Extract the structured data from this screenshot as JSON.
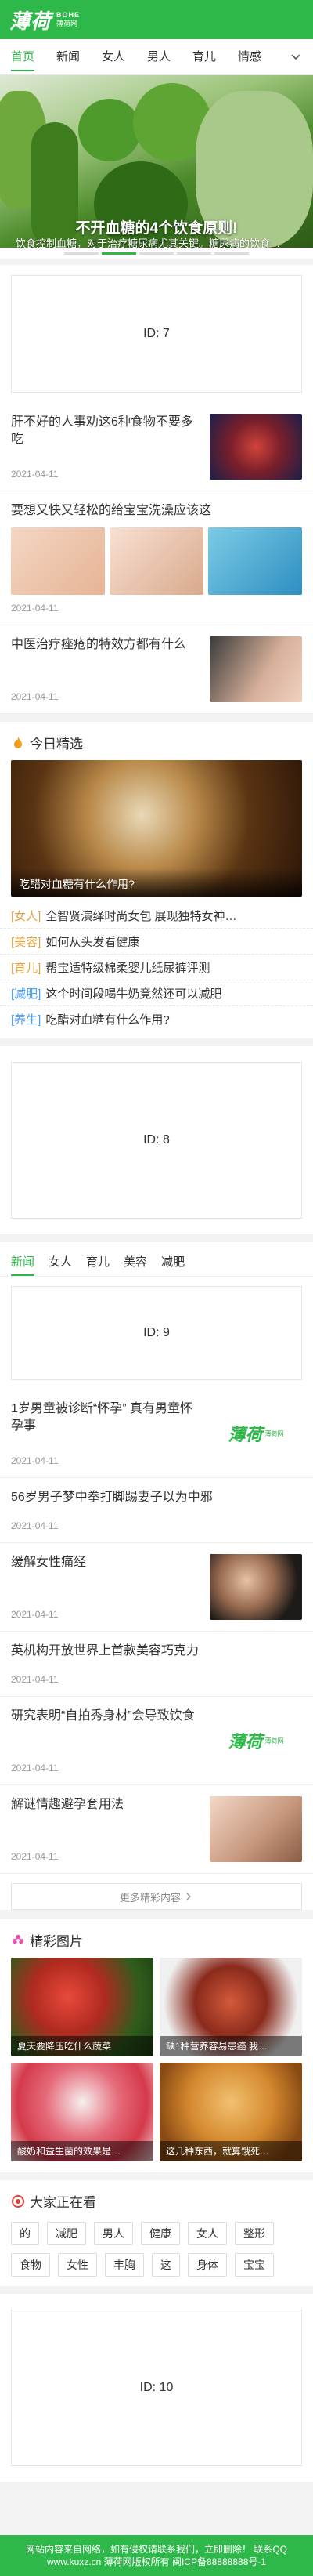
{
  "header": {
    "logo_text": "薄荷",
    "logo_en": "BOHE",
    "logo_sub": "薄荷网"
  },
  "nav": {
    "items": [
      "首页",
      "新闻",
      "女人",
      "男人",
      "育儿",
      "情感"
    ]
  },
  "hero": {
    "title": "不开血糖的4个饮食原则!",
    "desc": "饮食控制血糖，对于治疗糖尿病尤其关键。糖尿病的饮食…",
    "slides": 5,
    "active_slide": 2
  },
  "ads": {
    "ad1": "ID: 7",
    "ad2": "ID: 8",
    "ad3": "ID: 9",
    "ad4": "ID: 10"
  },
  "articles_top": [
    {
      "title": "肝不好的人事劝这6种食物不要多吃",
      "date": "2021-04-11"
    },
    {
      "title": "要想又快又轻松的给宝宝洗澡应该这",
      "date": "2021-04-11"
    },
    {
      "title": "中医治疗痤疮的特效方都有什么",
      "date": "2021-04-11"
    }
  ],
  "today": {
    "heading": "今日精选",
    "feature_caption": "吃醋对血糖有什么作用?",
    "items": [
      {
        "tag": "[女人]",
        "text": "全智贤演绎时尚女包 展现独特女神…",
        "color": "#e6a23c"
      },
      {
        "tag": "[美容]",
        "text": "如何从头发看健康",
        "color": "#e6a23c"
      },
      {
        "tag": "[育儿]",
        "text": "帮宝适特级棉柔婴儿纸尿裤评测",
        "color": "#e6a23c"
      },
      {
        "tag": "[减肥]",
        "text": "这个时间段喝牛奶竟然还可以减肥",
        "color": "#409eff"
      },
      {
        "tag": "[养生]",
        "text": "吃醋对血糖有什么作用?",
        "color": "#409eff"
      }
    ]
  },
  "tabs": {
    "items": [
      "新闻",
      "女人",
      "育儿",
      "美容",
      "减肥"
    ]
  },
  "articles_news": [
    {
      "title": "1岁男童被诊断“怀孕” 真有男童怀孕事",
      "date": "2021-04-11"
    },
    {
      "title": "56岁男子梦中拳打脚踢妻子以为中邪",
      "date": "2021-04-11"
    },
    {
      "title": "缓解女性痛经",
      "date": "2021-04-11"
    },
    {
      "title": "英机构开放世界上首款美容巧克力",
      "date": "2021-04-11"
    },
    {
      "title": "研究表明“自拍秀身材”会导致饮食",
      "date": "2021-04-11"
    },
    {
      "title": "解谜情趣避孕套用法",
      "date": "2021-04-11"
    }
  ],
  "more_label": "更多精彩内容",
  "gallery": {
    "heading": "精彩图片",
    "items": [
      {
        "caption": "夏天要降压吃什么蔬菜"
      },
      {
        "caption": "缺1种营养容易患癌 我…"
      },
      {
        "caption": "酸奶和益生菌的效果是…"
      },
      {
        "caption": "这几种东西，就算饿死…"
      }
    ]
  },
  "hot": {
    "heading": "大家正在看",
    "chips": [
      "的",
      "减肥",
      "男人",
      "健康",
      "女人",
      "整形",
      "食物",
      "女性",
      "丰胸",
      "这",
      "身体",
      "宝宝"
    ]
  },
  "footer": {
    "line1": "网站内容来自网络，如有侵权请联系我们，立即删除！ 联系QQ",
    "line2": "www.kuxz.cn 薄荷网版权所有 闽ICP备88888888号-1"
  },
  "colors": {
    "brand": "#2fb84a"
  }
}
